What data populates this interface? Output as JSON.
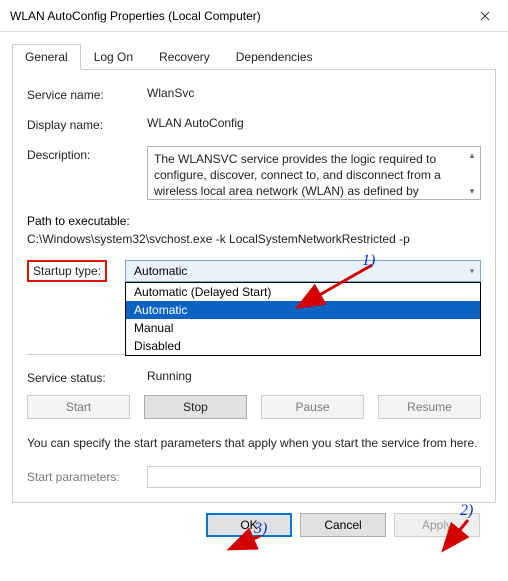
{
  "titlebar": {
    "title": "WLAN AutoConfig Properties (Local Computer)"
  },
  "tabs": {
    "items": [
      {
        "label": "General"
      },
      {
        "label": "Log On"
      },
      {
        "label": "Recovery"
      },
      {
        "label": "Dependencies"
      }
    ]
  },
  "general": {
    "serviceNameLabel": "Service name:",
    "serviceName": "WlanSvc",
    "displayNameLabel": "Display name:",
    "displayName": "WLAN AutoConfig",
    "descriptionLabel": "Description:",
    "description": "The WLANSVC service provides the logic required to configure, discover, connect to, and disconnect from a wireless local area network (WLAN) as defined by",
    "pathLabel": "Path to executable:",
    "path": "C:\\Windows\\system32\\svchost.exe -k LocalSystemNetworkRestricted -p",
    "startupLabel": "Startup type:",
    "startupSelected": "Automatic",
    "startupOptions": [
      {
        "label": "Automatic (Delayed Start)"
      },
      {
        "label": "Automatic"
      },
      {
        "label": "Manual"
      },
      {
        "label": "Disabled"
      }
    ],
    "statusLabel": "Service status:",
    "statusValue": "Running",
    "buttons": {
      "start": "Start",
      "stop": "Stop",
      "pause": "Pause",
      "resume": "Resume"
    },
    "helpText": "You can specify the start parameters that apply when you start the service from here.",
    "paramLabel": "Start parameters:",
    "paramValue": ""
  },
  "dialogButtons": {
    "ok": "OK",
    "cancel": "Cancel",
    "apply": "Apply"
  },
  "annotations": {
    "one": "1)",
    "two": "2)",
    "three": "3)"
  }
}
